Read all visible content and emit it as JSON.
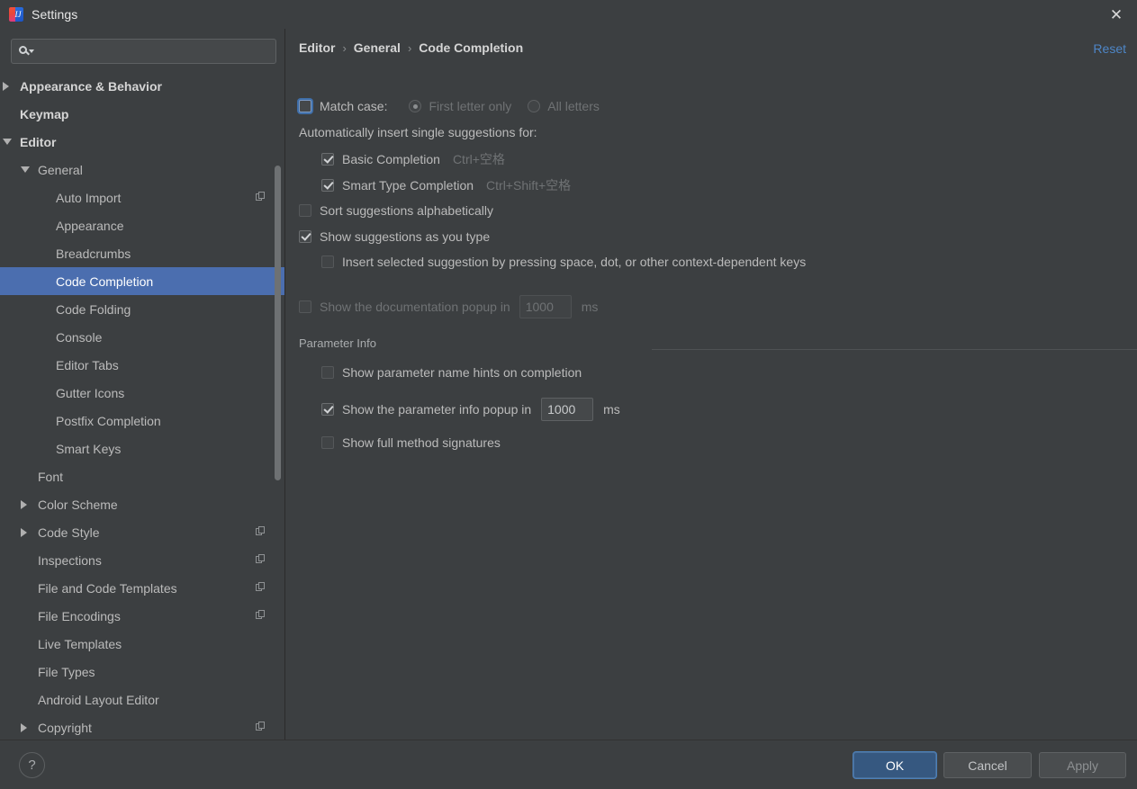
{
  "window": {
    "title": "Settings",
    "app_icon": "intellij-idea-icon",
    "close_icon": "close-icon"
  },
  "sidebar": {
    "search": {
      "value": "",
      "placeholder": "",
      "icon": "search-icon"
    },
    "items": [
      {
        "label": "Appearance & Behavior",
        "indent": 0,
        "twisty": "collapsed",
        "bold": true,
        "selected": false,
        "copy_icon": false
      },
      {
        "label": "Keymap",
        "indent": 0,
        "twisty": "none",
        "bold": true,
        "selected": false,
        "copy_icon": false
      },
      {
        "label": "Editor",
        "indent": 0,
        "twisty": "expanded",
        "bold": true,
        "selected": false,
        "copy_icon": false
      },
      {
        "label": "General",
        "indent": 1,
        "twisty": "expanded",
        "bold": false,
        "selected": false,
        "copy_icon": false
      },
      {
        "label": "Auto Import",
        "indent": 2,
        "twisty": "none",
        "bold": false,
        "selected": false,
        "copy_icon": true
      },
      {
        "label": "Appearance",
        "indent": 2,
        "twisty": "none",
        "bold": false,
        "selected": false,
        "copy_icon": false
      },
      {
        "label": "Breadcrumbs",
        "indent": 2,
        "twisty": "none",
        "bold": false,
        "selected": false,
        "copy_icon": false
      },
      {
        "label": "Code Completion",
        "indent": 2,
        "twisty": "none",
        "bold": false,
        "selected": true,
        "copy_icon": false
      },
      {
        "label": "Code Folding",
        "indent": 2,
        "twisty": "none",
        "bold": false,
        "selected": false,
        "copy_icon": false
      },
      {
        "label": "Console",
        "indent": 2,
        "twisty": "none",
        "bold": false,
        "selected": false,
        "copy_icon": false
      },
      {
        "label": "Editor Tabs",
        "indent": 2,
        "twisty": "none",
        "bold": false,
        "selected": false,
        "copy_icon": false
      },
      {
        "label": "Gutter Icons",
        "indent": 2,
        "twisty": "none",
        "bold": false,
        "selected": false,
        "copy_icon": false
      },
      {
        "label": "Postfix Completion",
        "indent": 2,
        "twisty": "none",
        "bold": false,
        "selected": false,
        "copy_icon": false
      },
      {
        "label": "Smart Keys",
        "indent": 2,
        "twisty": "none",
        "bold": false,
        "selected": false,
        "copy_icon": false
      },
      {
        "label": "Font",
        "indent": 1,
        "twisty": "none",
        "bold": false,
        "selected": false,
        "copy_icon": false
      },
      {
        "label": "Color Scheme",
        "indent": 1,
        "twisty": "collapsed",
        "bold": false,
        "selected": false,
        "copy_icon": false
      },
      {
        "label": "Code Style",
        "indent": 1,
        "twisty": "collapsed",
        "bold": false,
        "selected": false,
        "copy_icon": true
      },
      {
        "label": "Inspections",
        "indent": 1,
        "twisty": "none",
        "bold": false,
        "selected": false,
        "copy_icon": true
      },
      {
        "label": "File and Code Templates",
        "indent": 1,
        "twisty": "none",
        "bold": false,
        "selected": false,
        "copy_icon": true
      },
      {
        "label": "File Encodings",
        "indent": 1,
        "twisty": "none",
        "bold": false,
        "selected": false,
        "copy_icon": true
      },
      {
        "label": "Live Templates",
        "indent": 1,
        "twisty": "none",
        "bold": false,
        "selected": false,
        "copy_icon": false
      },
      {
        "label": "File Types",
        "indent": 1,
        "twisty": "none",
        "bold": false,
        "selected": false,
        "copy_icon": false
      },
      {
        "label": "Android Layout Editor",
        "indent": 1,
        "twisty": "none",
        "bold": false,
        "selected": false,
        "copy_icon": false
      },
      {
        "label": "Copyright",
        "indent": 1,
        "twisty": "collapsed",
        "bold": false,
        "selected": false,
        "copy_icon": true
      }
    ]
  },
  "main": {
    "breadcrumb": {
      "part1": "Editor",
      "part2": "General",
      "part3": "Code Completion",
      "separator": "›"
    },
    "reset_label": "Reset",
    "match_case": {
      "label": "Match case:",
      "checked": false,
      "options": [
        {
          "label": "First letter only",
          "selected": true
        },
        {
          "label": "All letters",
          "selected": false
        }
      ]
    },
    "auto_insert_label": "Automatically insert single suggestions for:",
    "auto_insert_items": [
      {
        "label": "Basic Completion",
        "shortcut": "Ctrl+空格",
        "checked": true
      },
      {
        "label": "Smart Type Completion",
        "shortcut": "Ctrl+Shift+空格",
        "checked": true
      }
    ],
    "sort_alphabetically": {
      "label": "Sort suggestions alphabetically",
      "checked": false
    },
    "show_as_you_type": {
      "label": "Show suggestions as you type",
      "checked": true
    },
    "insert_selected": {
      "label": "Insert selected suggestion by pressing space, dot, or other context-dependent keys",
      "checked": false
    },
    "doc_popup": {
      "label": "Show the documentation popup in",
      "checked": false,
      "value": "1000",
      "unit": "ms"
    },
    "parameter_info": {
      "group_title": "Parameter Info",
      "name_hints": {
        "label": "Show parameter name hints on completion",
        "checked": false
      },
      "popup": {
        "label": "Show the parameter info popup in",
        "checked": true,
        "value": "1000",
        "unit": "ms"
      },
      "full_signatures": {
        "label": "Show full method signatures",
        "checked": false
      }
    }
  },
  "footer": {
    "help_label": "?",
    "ok_label": "OK",
    "cancel_label": "Cancel",
    "apply_label": "Apply"
  },
  "colors": {
    "background": "#3c3f41",
    "selection": "#4b6eaf",
    "link": "#4e86c7",
    "primary_button": "#365880",
    "text": "#bbbbbb",
    "text_dim": "#6f7274"
  }
}
